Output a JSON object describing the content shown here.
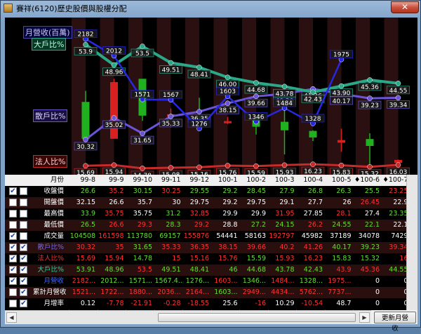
{
  "window": {
    "title": "賽祥(6120)歷史股價與股權分配",
    "close_glyph": "✕"
  },
  "chart": {
    "legend": {
      "revenue": "月營收(百萬)",
      "big": "大戶比%",
      "retail": "散戶比%",
      "inst": "法人比%"
    },
    "colors": {
      "revenue": "#2828e0",
      "big": "#2aa888",
      "retail": "#6a55d8",
      "inst": "#c62a2a",
      "up": "#d82020",
      "down": "#20b020"
    },
    "labels": {
      "revenue": [
        "2182",
        "2012",
        "1571",
        "1567",
        "1276",
        "1603",
        "1346",
        "1484",
        "1328",
        "1975",
        "",
        ""
      ],
      "big": [
        "53.9",
        "48.96",
        "53.5",
        "49.51",
        "48.41",
        "46.00",
        "44.68",
        "43.78",
        "42.43",
        "43.90",
        "45.36",
        "44.55"
      ],
      "retail": [
        "30.32",
        "35.02",
        "31.65",
        "35.33",
        "36.35",
        "38.15",
        "39.66",
        "40.20",
        "41.26",
        "40.17",
        "39.23",
        "39.34"
      ],
      "inst": [
        "15.69",
        "15.94",
        "14.78",
        "15.08",
        "15.16",
        "15.76",
        "15.59",
        "15.93",
        "16.23",
        "15.83",
        "15.32",
        "16.03"
      ]
    }
  },
  "grid": {
    "month_header": "月份",
    "months": [
      "99-8",
      "99-9",
      "99-10",
      "99-11",
      "99-12",
      "100-1",
      "100-2",
      "100-3",
      "100-4",
      "100-5",
      "♦100-6",
      "♦100-7"
    ],
    "rows": [
      {
        "label": "收盤價",
        "c1": "✔",
        "c2": "",
        "color": "#ffffff",
        "values": [
          "26.6",
          "35.2",
          "30.15",
          "30.25",
          "29.55",
          "29.2",
          "28.45",
          "27.9",
          "26.8",
          "26.3",
          "25.5",
          "23.25"
        ],
        "vcolors": [
          "#66dd33",
          "#ff3333",
          "#66dd33",
          "#ff3333",
          "#66dd33",
          "#66dd33",
          "#66dd33",
          "#66dd33",
          "#66dd33",
          "#66dd33",
          "#66dd33",
          "#ff3333"
        ]
      },
      {
        "label": "開盤價",
        "c1": "",
        "c2": "",
        "color": "#ffffff",
        "values": [
          "32.15",
          "26.6",
          "35.7",
          "30",
          "29.75",
          "29.2",
          "29.75",
          "29.1",
          "27.7",
          "26",
          "26.45",
          "22.9"
        ],
        "vcolors": [
          "#ffffff",
          "#ffffff",
          "#ffffff",
          "#ffffff",
          "#ffffff",
          "#ffffff",
          "#ffffff",
          "#ffffff",
          "#ffffff",
          "#ffffff",
          "#ff3333",
          "#ffffff"
        ]
      },
      {
        "label": "最高價",
        "c1": "",
        "c2": "",
        "color": "#ffffff",
        "values": [
          "33.9",
          "35.75",
          "35.75",
          "31.2",
          "32.85",
          "29.9",
          "29.9",
          "31.95",
          "27.85",
          "28.1",
          "27.4",
          "23.35"
        ],
        "vcolors": [
          "#66dd33",
          "#ff3333",
          "#ffffff",
          "#66dd33",
          "#ff3333",
          "#ffffff",
          "#ffffff",
          "#ff3333",
          "#ffffff",
          "#ff3333",
          "#ffffff",
          "#66dd33"
        ]
      },
      {
        "label": "最低價",
        "c1": "",
        "c2": "",
        "color": "#ffffff",
        "values": [
          "26.5",
          "26.6",
          "29.3",
          "28.3",
          "29.2",
          "28.8",
          "27.2",
          "24.15",
          "26.2",
          "24.55",
          "22.1",
          "22.1"
        ],
        "vcolors": [
          "#66dd33",
          "#ff3333",
          "#ff3333",
          "#66dd33",
          "#ff3333",
          "#ffffff",
          "#66dd33",
          "#66dd33",
          "#ff3333",
          "#66dd33",
          "#66dd33",
          "#ffffff"
        ]
      },
      {
        "label": "成交量",
        "c1": "✔",
        "c2": "",
        "color": "#ffffff",
        "values": [
          "104508",
          "161598",
          "113780",
          "69157",
          "155876",
          "54441",
          "58163",
          "192797",
          "45982",
          "37189",
          "34078",
          "7429"
        ],
        "vcolors": [
          "#66dd33",
          "#ff3333",
          "#66dd33",
          "#66dd33",
          "#ff3333",
          "#ffffff",
          "#ffffff",
          "#ff3333",
          "#ffffff",
          "#ffffff",
          "#ffffff",
          "#ffffff"
        ]
      },
      {
        "label": "散戶比%",
        "c1": "✔",
        "c2": "✔",
        "color": "#7766ee",
        "values": [
          "30.32",
          "35",
          "31.65",
          "35.33",
          "36.35",
          "38.15",
          "39.66",
          "40.2",
          "41.26",
          "40.17",
          "39.23",
          "39.34"
        ],
        "vcolors": [
          "#ff3333",
          "#ff3333",
          "#66dd33",
          "#ff3333",
          "#ff3333",
          "#ff3333",
          "#ff3333",
          "#ff3333",
          "#ff3333",
          "#66dd33",
          "#66dd33",
          "#ff3333"
        ]
      },
      {
        "label": "法人比%",
        "c1": "✔",
        "c2": "✔",
        "color": "#ee3333",
        "values": [
          "15.69",
          "15.94",
          "14.78",
          "15",
          "15.16",
          "15.76",
          "15.59",
          "15.93",
          "16.23",
          "15.83",
          "15.32",
          "16"
        ],
        "vcolors": [
          "#ff3333",
          "#ff3333",
          "#66dd33",
          "#ff3333",
          "#ff3333",
          "#ff3333",
          "#66dd33",
          "#ff3333",
          "#ff3333",
          "#66dd33",
          "#66dd33",
          "#ff3333"
        ]
      },
      {
        "label": "大戶比%",
        "c1": "✔",
        "c2": "✔",
        "color": "#33cc99",
        "values": [
          "53.91",
          "48.96",
          "53.5",
          "49.51",
          "48.41",
          "46",
          "44.68",
          "43.78",
          "42.43",
          "43.9",
          "45.36",
          "44.55"
        ],
        "vcolors": [
          "#66dd33",
          "#66dd33",
          "#ff3333",
          "#66dd33",
          "#66dd33",
          "#66dd33",
          "#66dd33",
          "#66dd33",
          "#66dd33",
          "#ff3333",
          "#ff3333",
          "#66dd33"
        ]
      },
      {
        "label": "月營收",
        "c1": "✔",
        "c2": "✔",
        "color": "#4466ff",
        "values": [
          "2182...",
          "2012...",
          "1571...",
          "1567.4...",
          "1276...",
          "1603...",
          "1346...",
          "1484...",
          "1328...",
          "1975...",
          "0",
          "0"
        ],
        "vcolors": [
          "#ff3333",
          "#66dd33",
          "#66dd33",
          "#66dd33",
          "#66dd33",
          "#ff3333",
          "#66dd33",
          "#ff3333",
          "#66dd33",
          "#ff3333",
          "#ffffff",
          "#ffffff"
        ]
      },
      {
        "label": "累計月營收",
        "c1": "",
        "c2": "✔",
        "color": "#ffffff",
        "values": [
          "1521...",
          "1722...",
          "1880...",
          "2036...",
          "2164...",
          "1603...",
          "2949...",
          "4434...",
          "5762...",
          "7737...",
          "0",
          "0"
        ],
        "vcolors": [
          "#ff3333",
          "#ff3333",
          "#ff3333",
          "#ff3333",
          "#ff3333",
          "#66dd33",
          "#ff3333",
          "#ff3333",
          "#ff3333",
          "#ff3333",
          "#ffffff",
          "#ffffff"
        ]
      },
      {
        "label": "月增率",
        "c1": "",
        "c2": "✔",
        "color": "#ffffff",
        "values": [
          "0.12",
          "-7.78",
          "-21.91",
          "-0.28",
          "-18.55",
          "25.6",
          "-16",
          "10.29",
          "-10.54",
          "48.7",
          "0",
          "0"
        ],
        "vcolors": [
          "#ffffff",
          "#ff3333",
          "#ff3333",
          "#ff3333",
          "#ff3333",
          "#ffffff",
          "#ff3333",
          "#ffffff",
          "#ff3333",
          "#ffffff",
          "#ffffff",
          "#ffffff"
        ]
      }
    ]
  },
  "footer": {
    "update_button": "更新月營收",
    "scroll_left": "◀",
    "scroll_right": "▶"
  }
}
